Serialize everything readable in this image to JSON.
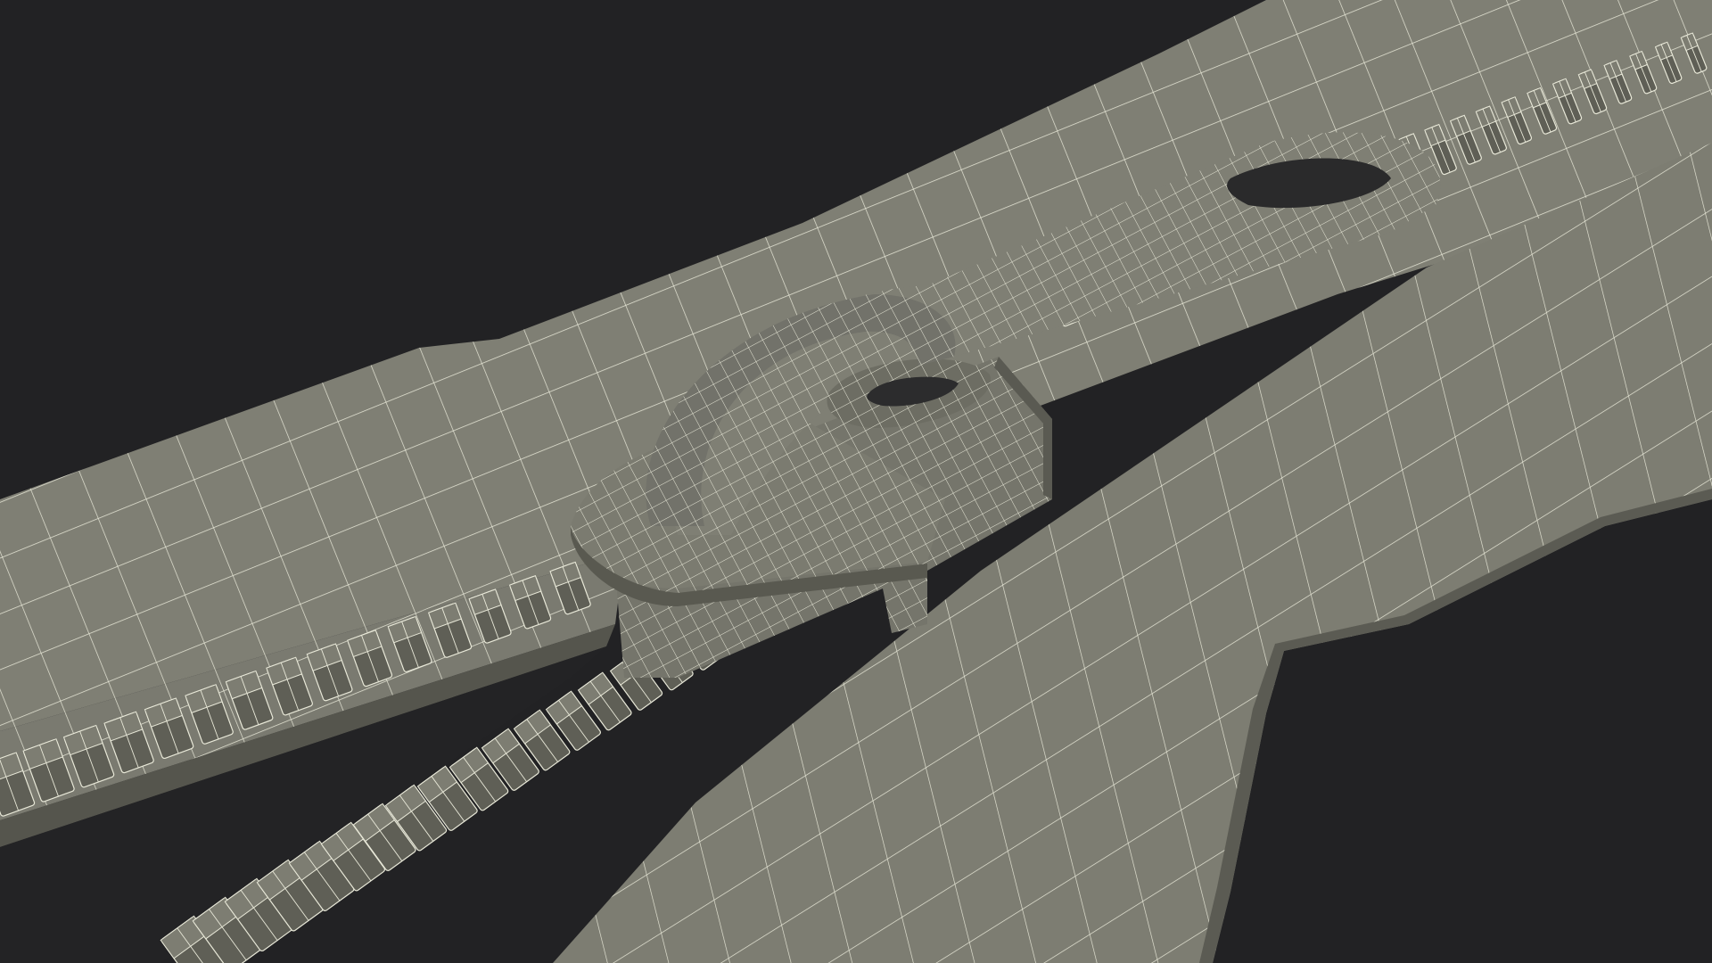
{
  "scene": {
    "subject": "zipper-wireframe-render",
    "colors": {
      "background": "#222224",
      "surface": "#7d7d72",
      "surface_dark": "#5f5f56",
      "surface_shadow": "#4a4a43",
      "wire": "#e8e8d8"
    }
  }
}
